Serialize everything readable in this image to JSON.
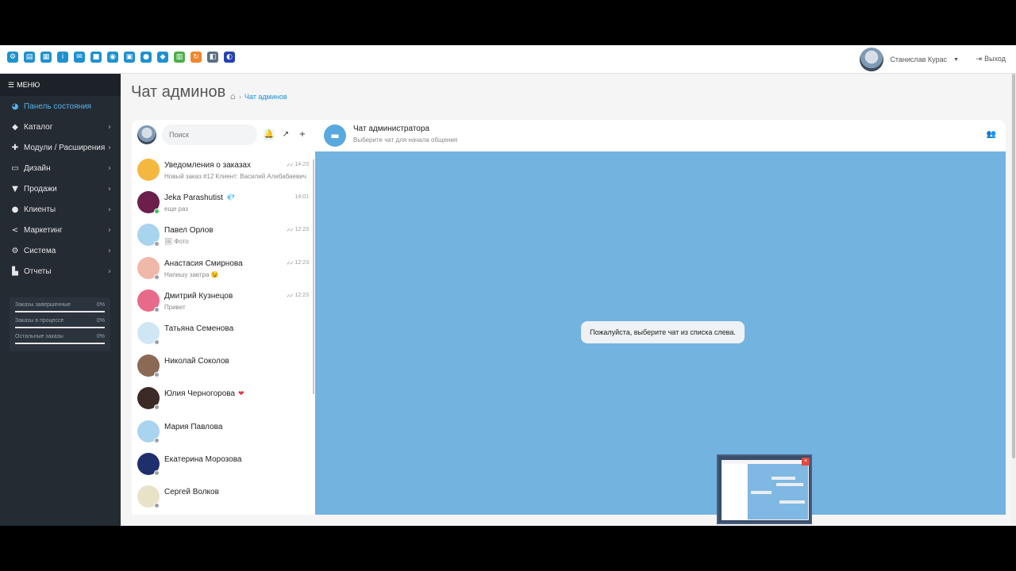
{
  "topbar": {
    "quick_icons": [
      {
        "name": "settings-icon",
        "glyph": "⚙",
        "tone": "blue"
      },
      {
        "name": "folder-icon",
        "glyph": "▤",
        "tone": "blue"
      },
      {
        "name": "grid-icon",
        "glyph": "▦",
        "tone": "blue"
      },
      {
        "name": "info-icon",
        "glyph": "i",
        "tone": "blue"
      },
      {
        "name": "comments-icon",
        "glyph": "✉",
        "tone": "blue"
      },
      {
        "name": "truck-icon",
        "glyph": "■",
        "tone": "blue"
      },
      {
        "name": "money-icon",
        "glyph": "◉",
        "tone": "blue"
      },
      {
        "name": "cart-icon",
        "glyph": "▣",
        "tone": "blue"
      },
      {
        "name": "users-icon",
        "glyph": "●",
        "tone": "blue"
      },
      {
        "name": "sitemap-icon",
        "glyph": "◆",
        "tone": "blue"
      },
      {
        "name": "spreadsheet-icon",
        "glyph": "▥",
        "tone": "green"
      },
      {
        "name": "refresh-icon",
        "glyph": "↻",
        "tone": "orange"
      },
      {
        "name": "puzzle-icon",
        "glyph": "◧",
        "tone": "gray"
      },
      {
        "name": "chat-bubbles-icon",
        "glyph": "◐",
        "tone": "navy"
      }
    ],
    "user_name": "Станислав Курас",
    "logout_label": "Выход"
  },
  "sidebar": {
    "menu_label": "МЕНЮ",
    "items": [
      {
        "label": "Панель состояния",
        "icon": "dashboard-icon",
        "glyph": "◕",
        "active": true,
        "chevron": false
      },
      {
        "label": "Каталог",
        "icon": "tag-icon",
        "glyph": "◆",
        "active": false,
        "chevron": true
      },
      {
        "label": "Модули / Расширения",
        "icon": "puzzle-icon",
        "glyph": "✚",
        "active": false,
        "chevron": true
      },
      {
        "label": "Дизайн",
        "icon": "monitor-icon",
        "glyph": "▭",
        "active": false,
        "chevron": true
      },
      {
        "label": "Продажи",
        "icon": "cart-icon",
        "glyph": "▼",
        "active": false,
        "chevron": true
      },
      {
        "label": "Клиенты",
        "icon": "user-icon",
        "glyph": "●",
        "active": false,
        "chevron": true
      },
      {
        "label": "Маркетинг",
        "icon": "share-icon",
        "glyph": "<",
        "active": false,
        "chevron": true
      },
      {
        "label": "Система",
        "icon": "gear-icon",
        "glyph": "⚙",
        "active": false,
        "chevron": true
      },
      {
        "label": "Отчеты",
        "icon": "bar-chart-icon",
        "glyph": "▙",
        "active": false,
        "chevron": true
      }
    ],
    "stats": [
      {
        "label": "Заказы завершенные",
        "value": "0%",
        "progress": 0
      },
      {
        "label": "Заказы в процессе",
        "value": "0%",
        "progress": 0
      },
      {
        "label": "Остальные заказы",
        "value": "0%",
        "progress": 0
      }
    ]
  },
  "page": {
    "title": "Чат админов",
    "breadcrumb_link": "Чат админов"
  },
  "chat_list": {
    "search_placeholder": "Поиск",
    "items": [
      {
        "name": "Уведомления о заказах",
        "message": "Новый заказ #12 Клиент: Василий Алибабаевич",
        "time": "14:23",
        "read_ticks": true,
        "status": "",
        "extra": "",
        "avatar": "#f4b740"
      },
      {
        "name": "Jeka Parashutist",
        "message": "еще раз",
        "time": "14:01",
        "read_ticks": false,
        "status": "online",
        "extra": "💎",
        "avatar": "#6b1f4a"
      },
      {
        "name": "Павел Орлов",
        "message": "🖼 Фото",
        "time": "12:23",
        "read_ticks": true,
        "status": "offline",
        "extra": "",
        "avatar": "#a9d4ef"
      },
      {
        "name": "Анастасия Смирнова",
        "message": "Напишу завтра 😉",
        "time": "12:23",
        "read_ticks": true,
        "status": "offline",
        "extra": "",
        "avatar": "#f0b8a8"
      },
      {
        "name": "Дмитрий Кузнецов",
        "message": "Привет",
        "time": "12:23",
        "read_ticks": true,
        "status": "offline",
        "extra": "",
        "avatar": "#e86a8a"
      },
      {
        "name": "Татьяна Семенова",
        "message": "",
        "time": "",
        "read_ticks": false,
        "status": "offline",
        "extra": "",
        "avatar": "#cfe6f5"
      },
      {
        "name": "Николай Соколов",
        "message": "",
        "time": "",
        "read_ticks": false,
        "status": "offline",
        "extra": "",
        "avatar": "#8a6a55"
      },
      {
        "name": "Юлия Черногорова",
        "message": "",
        "time": "",
        "read_ticks": false,
        "status": "offline",
        "extra": "❤",
        "avatar": "#3b2a25"
      },
      {
        "name": "Мария Павлова",
        "message": "",
        "time": "",
        "read_ticks": false,
        "status": "offline",
        "extra": "",
        "avatar": "#a9d4ef"
      },
      {
        "name": "Екатерина Морозова",
        "message": "",
        "time": "",
        "read_ticks": false,
        "status": "offline",
        "extra": "",
        "avatar": "#1e2f6b"
      },
      {
        "name": "Сергей Волков",
        "message": "",
        "time": "",
        "read_ticks": false,
        "status": "offline",
        "extra": "",
        "avatar": "#e8e2c8"
      }
    ]
  },
  "conversation": {
    "title": "Чат администратора",
    "subtitle": "Выберите чат для начала общения",
    "placeholder": "Пожалуйста, выберите чат из списка слева."
  },
  "colors": {
    "accent": "#1e91cf",
    "sidebar_bg": "#242b33",
    "chat_bg": "#72b3e0"
  }
}
